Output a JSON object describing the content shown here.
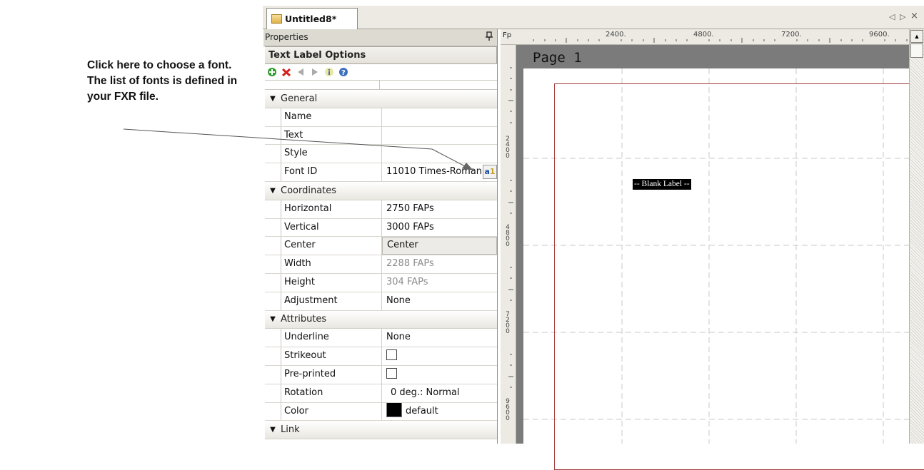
{
  "annotation": {
    "lines": [
      "Click here to choose a font.",
      "The list of fonts is defined in",
      "your FXR file."
    ]
  },
  "document_tab": {
    "label": "Untitled8*"
  },
  "window_controls": {
    "prev": "◁",
    "next": "▷",
    "close": "×"
  },
  "properties": {
    "title": "Properties",
    "pin_glyph": "ꟸ",
    "section_title": "Text Label Options",
    "toolbar_icons": [
      "add-icon",
      "delete-icon",
      "back-icon",
      "forward-icon",
      "info-icon",
      "help-icon"
    ],
    "categories": [
      {
        "label": "General",
        "rows": [
          {
            "name": "Name",
            "value": ""
          },
          {
            "name": "Text",
            "value": ""
          },
          {
            "name": "Style",
            "value": ""
          },
          {
            "name": "Font ID",
            "value": "11010 Times-Roman"
          }
        ]
      },
      {
        "label": "Coordinates",
        "rows": [
          {
            "name": "Horizontal",
            "value": "2750 FAPs"
          },
          {
            "name": "Vertical",
            "value": "3000 FAPs"
          },
          {
            "name": "Center",
            "value": "Center"
          },
          {
            "name": "Width",
            "value": "2288 FAPs"
          },
          {
            "name": "Height",
            "value": "304 FAPs"
          },
          {
            "name": "Adjustment",
            "value": "None"
          }
        ]
      },
      {
        "label": "Attributes",
        "rows": [
          {
            "name": "Underline",
            "value": "None"
          },
          {
            "name": "Strikeout",
            "value": ""
          },
          {
            "name": "Pre-printed",
            "value": ""
          },
          {
            "name": "Rotation",
            "value": "0 deg.: Normal"
          },
          {
            "name": "Color",
            "value": "default"
          }
        ]
      },
      {
        "label": "Link"
      }
    ]
  },
  "ruler": {
    "unit": "Fp",
    "top_labels": [
      "2400.",
      "4800.",
      "7200.",
      "9600."
    ],
    "left_labels": [
      "2400",
      "4800",
      "7200",
      "9600"
    ]
  },
  "canvas": {
    "page_title": "Page 1",
    "label_text": "-- Blank Label --"
  },
  "colors": {
    "margin_line": "#a23a3a",
    "canvas_gray": "#7b7b7b",
    "color_swatch": "#000000"
  }
}
